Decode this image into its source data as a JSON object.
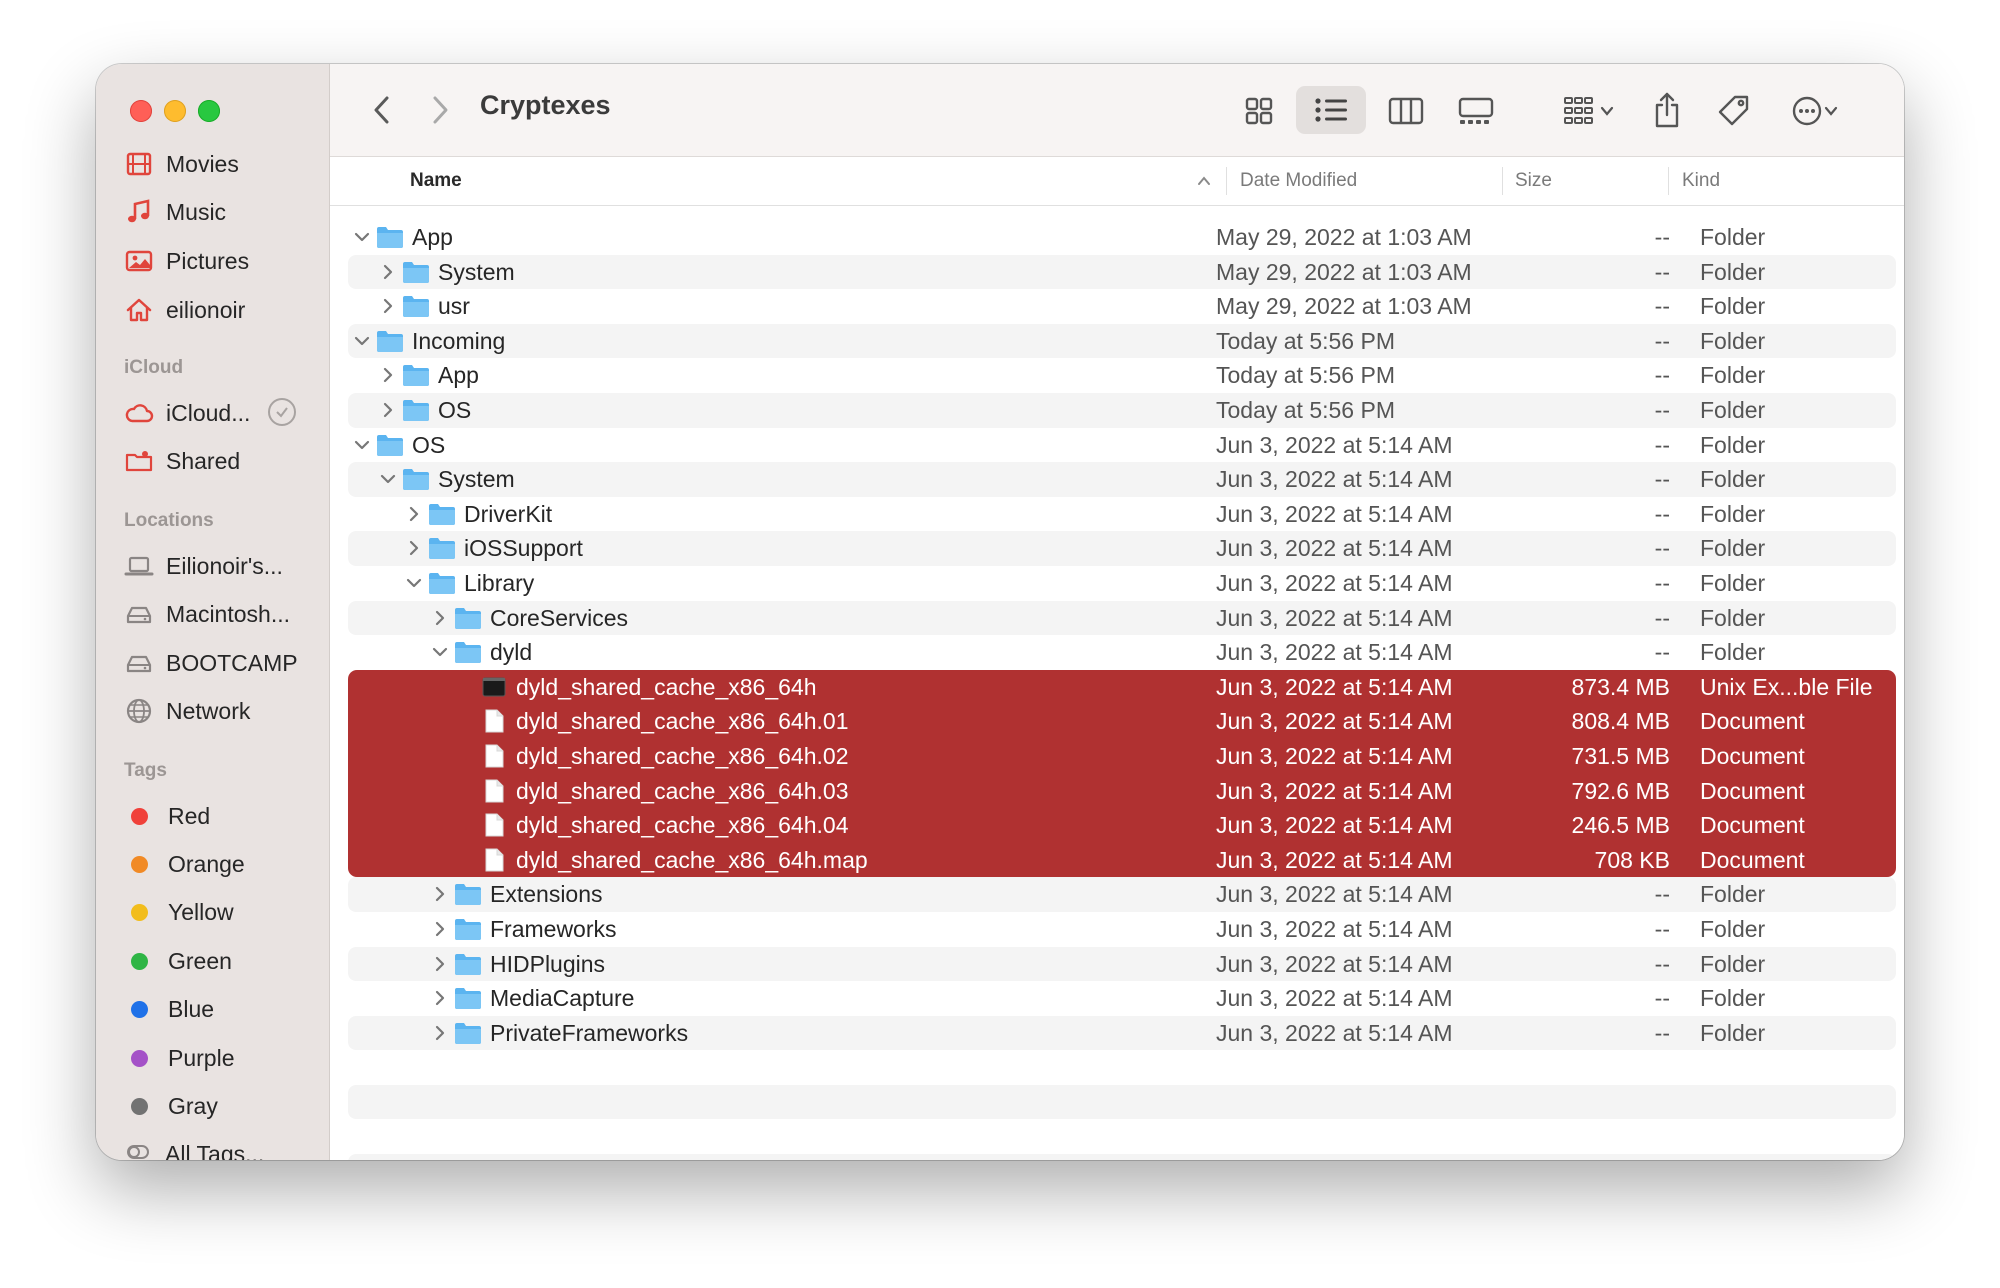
{
  "window": {
    "title": "Cryptexes"
  },
  "sidebar": {
    "favorites": [
      {
        "label": "Movies",
        "icon": "film-icon",
        "color": "#e0453c"
      },
      {
        "label": "Music",
        "icon": "music-note-icon",
        "color": "#e0453c"
      },
      {
        "label": "Pictures",
        "icon": "photo-icon",
        "color": "#e0453c"
      },
      {
        "label": "eilionoir",
        "icon": "home-icon",
        "color": "#e0453c"
      }
    ],
    "icloud_header": "iCloud",
    "icloud": [
      {
        "label": "iCloud...",
        "icon": "cloud-icon",
        "color": "#e0453c"
      },
      {
        "label": "Shared",
        "icon": "shared-folder-icon",
        "color": "#e0453c"
      }
    ],
    "locations_header": "Locations",
    "locations": [
      {
        "label": "Eilionoir's...",
        "icon": "laptop-icon"
      },
      {
        "label": "Macintosh...",
        "icon": "disk-icon"
      },
      {
        "label": "BOOTCAMP",
        "icon": "disk-icon"
      },
      {
        "label": "Network",
        "icon": "globe-icon"
      }
    ],
    "tags_header": "Tags",
    "tags": [
      {
        "label": "Red",
        "color": "#f0413a"
      },
      {
        "label": "Orange",
        "color": "#f18a25"
      },
      {
        "label": "Yellow",
        "color": "#f2bd1c"
      },
      {
        "label": "Green",
        "color": "#2fb545"
      },
      {
        "label": "Blue",
        "color": "#1f71e8"
      },
      {
        "label": "Purple",
        "color": "#a451c7"
      },
      {
        "label": "Gray",
        "color": "#727272"
      },
      {
        "label": "All Tags...",
        "color": ""
      }
    ]
  },
  "columns": {
    "name": "Name",
    "date": "Date Modified",
    "size": "Size",
    "kind": "Kind"
  },
  "rows": [
    {
      "name": "App",
      "depth": 0,
      "disclosure": "open",
      "type": "folder",
      "date": "May 29, 2022 at 1:03 AM",
      "size": "--",
      "kind": "Folder"
    },
    {
      "name": "System",
      "depth": 1,
      "disclosure": "closed",
      "type": "folder",
      "date": "May 29, 2022 at 1:03 AM",
      "size": "--",
      "kind": "Folder"
    },
    {
      "name": "usr",
      "depth": 1,
      "disclosure": "closed",
      "type": "folder",
      "date": "May 29, 2022 at 1:03 AM",
      "size": "--",
      "kind": "Folder"
    },
    {
      "name": "Incoming",
      "depth": 0,
      "disclosure": "open",
      "type": "folder",
      "date": "Today at 5:56 PM",
      "size": "--",
      "kind": "Folder"
    },
    {
      "name": "App",
      "depth": 1,
      "disclosure": "closed",
      "type": "folder",
      "date": "Today at 5:56 PM",
      "size": "--",
      "kind": "Folder"
    },
    {
      "name": "OS",
      "depth": 1,
      "disclosure": "closed",
      "type": "folder",
      "date": "Today at 5:56 PM",
      "size": "--",
      "kind": "Folder"
    },
    {
      "name": "OS",
      "depth": 0,
      "disclosure": "open",
      "type": "folder",
      "date": "Jun 3, 2022 at 5:14 AM",
      "size": "--",
      "kind": "Folder"
    },
    {
      "name": "System",
      "depth": 1,
      "disclosure": "open",
      "type": "folder",
      "date": "Jun 3, 2022 at 5:14 AM",
      "size": "--",
      "kind": "Folder"
    },
    {
      "name": "DriverKit",
      "depth": 2,
      "disclosure": "closed",
      "type": "folder",
      "date": "Jun 3, 2022 at 5:14 AM",
      "size": "--",
      "kind": "Folder"
    },
    {
      "name": "iOSSupport",
      "depth": 2,
      "disclosure": "closed",
      "type": "folder",
      "date": "Jun 3, 2022 at 5:14 AM",
      "size": "--",
      "kind": "Folder"
    },
    {
      "name": "Library",
      "depth": 2,
      "disclosure": "open",
      "type": "folder",
      "date": "Jun 3, 2022 at 5:14 AM",
      "size": "--",
      "kind": "Folder"
    },
    {
      "name": "CoreServices",
      "depth": 3,
      "disclosure": "closed",
      "type": "folder",
      "date": "Jun 3, 2022 at 5:14 AM",
      "size": "--",
      "kind": "Folder"
    },
    {
      "name": "dyld",
      "depth": 3,
      "disclosure": "open",
      "type": "folder",
      "date": "Jun 3, 2022 at 5:14 AM",
      "size": "--",
      "kind": "Folder"
    },
    {
      "name": "dyld_shared_cache_x86_64h",
      "depth": 4,
      "disclosure": "none",
      "type": "exec",
      "selected": true,
      "date": "Jun 3, 2022 at 5:14 AM",
      "size": "873.4 MB",
      "kind": "Unix Ex...ble File"
    },
    {
      "name": "dyld_shared_cache_x86_64h.01",
      "depth": 4,
      "disclosure": "none",
      "type": "doc",
      "selected": true,
      "date": "Jun 3, 2022 at 5:14 AM",
      "size": "808.4 MB",
      "kind": "Document"
    },
    {
      "name": "dyld_shared_cache_x86_64h.02",
      "depth": 4,
      "disclosure": "none",
      "type": "doc",
      "selected": true,
      "date": "Jun 3, 2022 at 5:14 AM",
      "size": "731.5 MB",
      "kind": "Document"
    },
    {
      "name": "dyld_shared_cache_x86_64h.03",
      "depth": 4,
      "disclosure": "none",
      "type": "doc",
      "selected": true,
      "date": "Jun 3, 2022 at 5:14 AM",
      "size": "792.6 MB",
      "kind": "Document"
    },
    {
      "name": "dyld_shared_cache_x86_64h.04",
      "depth": 4,
      "disclosure": "none",
      "type": "doc",
      "selected": true,
      "date": "Jun 3, 2022 at 5:14 AM",
      "size": "246.5 MB",
      "kind": "Document"
    },
    {
      "name": "dyld_shared_cache_x86_64h.map",
      "depth": 4,
      "disclosure": "none",
      "type": "doc",
      "selected": true,
      "date": "Jun 3, 2022 at 5:14 AM",
      "size": "708 KB",
      "kind": "Document"
    },
    {
      "name": "Extensions",
      "depth": 3,
      "disclosure": "closed",
      "type": "folder",
      "date": "Jun 3, 2022 at 5:14 AM",
      "size": "--",
      "kind": "Folder"
    },
    {
      "name": "Frameworks",
      "depth": 3,
      "disclosure": "closed",
      "type": "folder",
      "date": "Jun 3, 2022 at 5:14 AM",
      "size": "--",
      "kind": "Folder"
    },
    {
      "name": "HIDPlugins",
      "depth": 3,
      "disclosure": "closed",
      "type": "folder",
      "date": "Jun 3, 2022 at 5:14 AM",
      "size": "--",
      "kind": "Folder"
    },
    {
      "name": "MediaCapture",
      "depth": 3,
      "disclosure": "closed",
      "type": "folder",
      "date": "Jun 3, 2022 at 5:14 AM",
      "size": "--",
      "kind": "Folder"
    },
    {
      "name": "PrivateFrameworks",
      "depth": 3,
      "disclosure": "closed",
      "type": "folder",
      "date": "Jun 3, 2022 at 5:14 AM",
      "size": "--",
      "kind": "Folder"
    }
  ],
  "colors": {
    "selection": "#b03131",
    "folder": "#5bb4f0",
    "sidebar_accent": "#e0453c"
  }
}
